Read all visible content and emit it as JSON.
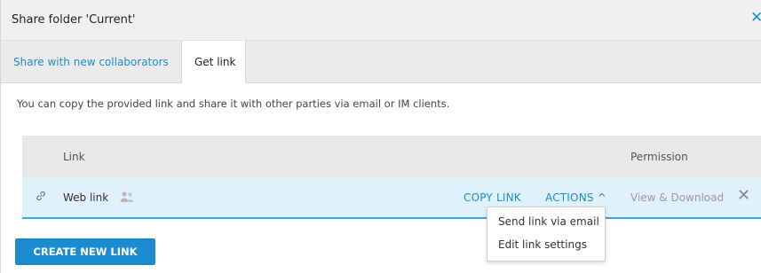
{
  "dialog": {
    "title": "Share folder 'Current'",
    "close_symbol": "✕"
  },
  "tabs": [
    {
      "label": "Share with new collaborators",
      "active": false
    },
    {
      "label": "Get link",
      "active": true
    }
  ],
  "description": "You can copy the provided link and share it with other parties via email or IM clients.",
  "table": {
    "columns": [
      "Link",
      "Permission"
    ],
    "rows": [
      {
        "name": "Web link",
        "icon": "link-icon",
        "secondary_icon": "people-icon",
        "copy_label": "COPY LINK",
        "actions_label": "ACTIONS ^",
        "permission": "View & Download",
        "remove_symbol": "✕"
      }
    ]
  },
  "actions_menu": {
    "items": [
      "Send link via email",
      "Edit link settings"
    ]
  },
  "footer": {
    "create_button": "CREATE NEW LINK"
  },
  "colors": {
    "accent": "#1a8ccf",
    "row_highlight": "#dff2fb",
    "header_bg": "#e8e8e8"
  }
}
